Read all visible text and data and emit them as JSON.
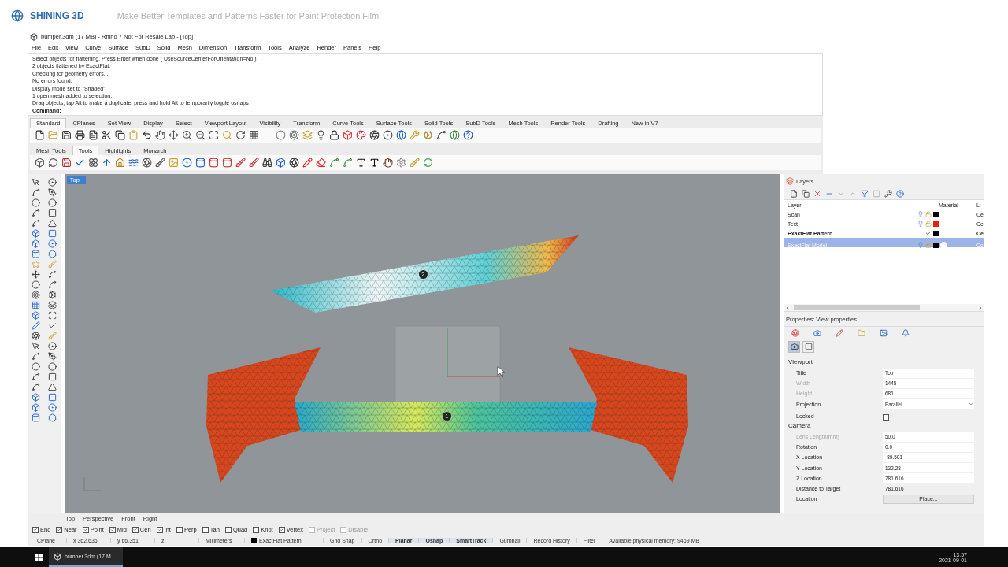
{
  "header": {
    "logo": "SHINING 3D",
    "tagline": "Make Better Templates and Patterns Faster for Paint Protection Film"
  },
  "window": {
    "title": "bumper.3dm (17 MB) - Rhino 7 Not For Resale Lab - [Top]",
    "menu": [
      "File",
      "Edit",
      "View",
      "Curve",
      "Surface",
      "SubD",
      "Solid",
      "Mesh",
      "Dimension",
      "Transform",
      "Tools",
      "Analyze",
      "Render",
      "Panels",
      "Help"
    ]
  },
  "command_history": [
    "Select objects for flattening. Press Enter when done ( UseSourceCenterForOrientation=No )",
    "2 objects flattened by ExactFlat.",
    "Checking for geometry errors...",
    "No errors found.",
    "Display mode set to \"Shaded\".",
    "1 open mesh added to selection.",
    "Drag objects, tap Alt to make a duplicate, press and hold Alt to temporarily toggle osnaps"
  ],
  "command_prompt": "Command:",
  "toolbar_tabs": [
    {
      "label": "Standard",
      "selected": true
    },
    {
      "label": "CPlanes",
      "selected": false
    },
    {
      "label": "Set View",
      "selected": false
    },
    {
      "label": "Display",
      "selected": false
    },
    {
      "label": "Select",
      "selected": false
    },
    {
      "label": "Viewport Layout",
      "selected": false
    },
    {
      "label": "Visibility",
      "selected": false
    },
    {
      "label": "Transform",
      "selected": false
    },
    {
      "label": "Curve Tools",
      "selected": false
    },
    {
      "label": "Surface Tools",
      "selected": false
    },
    {
      "label": "Solid Tools",
      "selected": false
    },
    {
      "label": "SubD Tools",
      "selected": false
    },
    {
      "label": "Mesh Tools",
      "selected": false
    },
    {
      "label": "Render Tools",
      "selected": false
    },
    {
      "label": "Drafting",
      "selected": false
    },
    {
      "label": "New in V7",
      "selected": false
    }
  ],
  "toolbar2_tabs": [
    {
      "label": "Mesh Tools",
      "selected": false
    },
    {
      "label": "Tools",
      "selected": true
    },
    {
      "label": "Highlights",
      "selected": false
    },
    {
      "label": "Monarch",
      "selected": false
    }
  ],
  "viewport": {
    "label": "Top",
    "markers": [
      "2",
      "1"
    ]
  },
  "layers": {
    "title": "Layers",
    "columns": [
      "Layer",
      "Material",
      "Li"
    ],
    "rows": [
      {
        "name": "Scan",
        "current": false,
        "selected": false,
        "material": false,
        "color": "#000000",
        "column_3": "Ce"
      },
      {
        "name": "Text",
        "current": false,
        "selected": false,
        "material": false,
        "color": "#e8200c",
        "column_3": "Cc"
      },
      {
        "name": "ExactFlat Pattern",
        "current": true,
        "selected": false,
        "material": false,
        "color": "#000000",
        "column_3": "Ce"
      },
      {
        "name": "ExactFlat Model",
        "current": false,
        "selected": true,
        "material": true,
        "color": "#000000",
        "column_3": "Cc"
      }
    ]
  },
  "properties": {
    "title": "Properties: View properties",
    "sections": [
      {
        "title": "Viewport",
        "rows": [
          {
            "label": "Title",
            "value": "Top",
            "kind": "text",
            "disabled": false
          },
          {
            "label": "Width",
            "value": "1445",
            "kind": "text",
            "disabled": true
          },
          {
            "label": "Height",
            "value": "681",
            "kind": "text",
            "disabled": true
          },
          {
            "label": "Projection",
            "value": "Parallel",
            "kind": "dropdown",
            "disabled": false
          },
          {
            "label": "Locked",
            "kind": "checkbox",
            "checked": false,
            "disabled": false
          }
        ]
      },
      {
        "title": "Camera",
        "rows": [
          {
            "label": "Lens Length(mm)",
            "value": "50.0",
            "kind": "text",
            "disabled": true
          },
          {
            "label": "Rotation",
            "value": "0.0",
            "kind": "text",
            "disabled": false
          },
          {
            "label": "X Location",
            "value": "-89.501",
            "kind": "text",
            "disabled": false
          },
          {
            "label": "Y Location",
            "value": "132.28",
            "kind": "text",
            "disabled": false
          },
          {
            "label": "Z Location",
            "value": "781.616",
            "kind": "text",
            "disabled": false
          },
          {
            "label": "Distance to Target",
            "value": "781.616",
            "kind": "readonly",
            "disabled": false
          },
          {
            "label": "Location",
            "value": "Place...",
            "kind": "button",
            "disabled": false
          }
        ]
      }
    ]
  },
  "viewport_tabs": [
    "Top",
    "Perspective",
    "Front",
    "Right"
  ],
  "osnaps": [
    {
      "label": "End",
      "checked": true,
      "disabled": false
    },
    {
      "label": "Near",
      "checked": true,
      "disabled": false
    },
    {
      "label": "Point",
      "checked": true,
      "disabled": false
    },
    {
      "label": "Mid",
      "checked": true,
      "disabled": false
    },
    {
      "label": "Cen",
      "checked": true,
      "disabled": false
    },
    {
      "label": "Int",
      "checked": true,
      "disabled": false
    },
    {
      "label": "Perp",
      "checked": false,
      "disabled": false
    },
    {
      "label": "Tan",
      "checked": false,
      "disabled": false
    },
    {
      "label": "Quad",
      "checked": false,
      "disabled": false
    },
    {
      "label": "Knot",
      "checked": false,
      "disabled": false
    },
    {
      "label": "Vertex",
      "checked": true,
      "disabled": false
    },
    {
      "label": "Project",
      "checked": false,
      "disabled": true
    },
    {
      "label": "Disable",
      "checked": false,
      "disabled": true
    }
  ],
  "status_bar": {
    "cplane": "CPlane",
    "x": "x 362.636",
    "y": "y 66.351",
    "z": "z",
    "units": "Millimeters",
    "layer": "ExactFlat Pattern",
    "toggles": [
      {
        "label": "Grid Snap",
        "on": false
      },
      {
        "label": "Ortho",
        "on": false
      },
      {
        "label": "Planar",
        "on": true
      },
      {
        "label": "Osnap",
        "on": true
      },
      {
        "label": "SmartTrack",
        "on": true
      },
      {
        "label": "Gumball",
        "on": false
      },
      {
        "label": "Record History",
        "on": false
      },
      {
        "label": "Filter",
        "on": false
      }
    ],
    "memory": "Available physical memory: 9469 MB"
  },
  "taskbar": {
    "app": "bumper.3dm (17 M...",
    "time": "13:57",
    "date": "2021-09-01"
  }
}
